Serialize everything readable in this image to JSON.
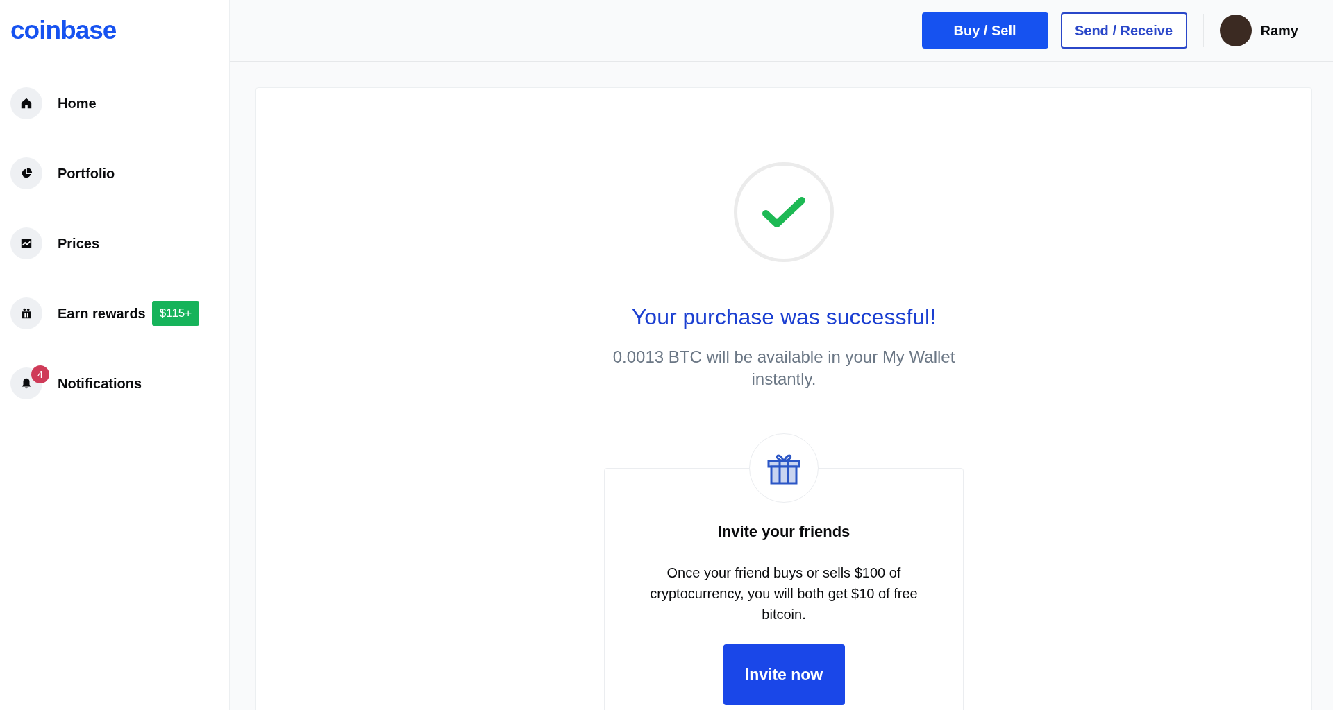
{
  "sidebar": {
    "logo": "coinbase",
    "items": [
      {
        "label": "Home"
      },
      {
        "label": "Portfolio"
      },
      {
        "label": "Prices"
      },
      {
        "label": "Earn rewards",
        "tag": "$115+"
      },
      {
        "label": "Notifications",
        "count": "4"
      }
    ]
  },
  "header": {
    "buttons": [
      {
        "label": "Buy / Sell",
        "kind": "primary"
      },
      {
        "label": "Send / Receive",
        "kind": "outline"
      }
    ],
    "user": {
      "name": "Ramy"
    }
  },
  "confirmation": {
    "title": "Your purchase was successful!",
    "message": "0.0013 BTC will be available in your My Wallet instantly."
  },
  "invite_card": {
    "title": "Invite your friends",
    "body": "Once your friend buys or sells $100 of cryptocurrency, you will both get $10 of free bitcoin.",
    "button": "Invite now"
  }
}
